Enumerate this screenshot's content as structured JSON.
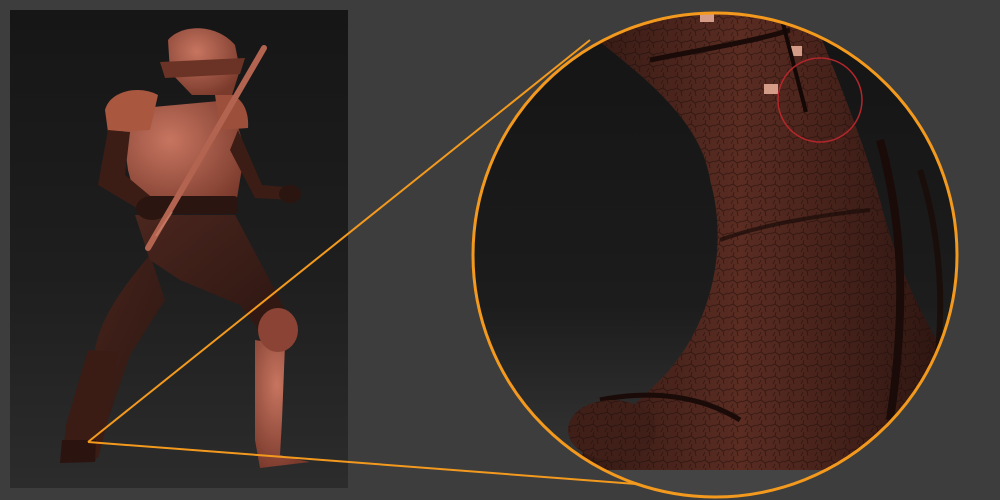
{
  "scene": {
    "subject": "sculpted-ninja-figure",
    "accent_color": "#f39a1e",
    "highlight_color": "#b3262b",
    "skin_color": "#b5604c",
    "cloth_color": "#3a1d17",
    "background_color": "#3d3d3d"
  },
  "callout": {
    "source_point": "left-foot",
    "shape": "circle"
  }
}
